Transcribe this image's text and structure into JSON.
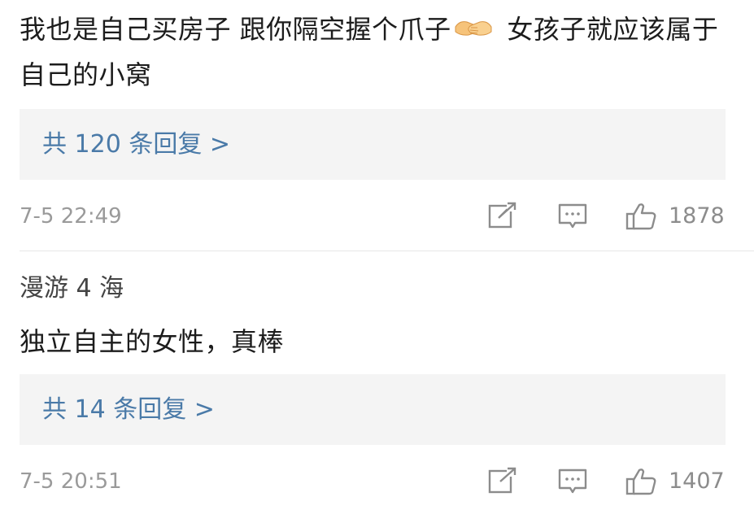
{
  "comments": [
    {
      "text_before_emoji": "我也是自己买房子  跟你隔空握个爪子",
      "emoji": "handshake-emoji",
      "text_after_emoji": " 女孩子就应该属于自己的小窝",
      "replies_label": "共 120 条回复 >",
      "time": "7-5 22:49",
      "likes": "1878"
    },
    {
      "username": "漫游 4 海",
      "text": "独立自主的女性，真棒",
      "replies_label": "共 14 条回复 >",
      "time": "7-5 20:51",
      "likes": "1407"
    }
  ],
  "icons": {
    "share": "share-icon",
    "comment": "comment-icon",
    "like": "thumbs-up-icon"
  },
  "colors": {
    "reply_link": "#4a7aa8",
    "reply_box_bg": "#f4f4f4",
    "meta_text": "#9a9a9a"
  }
}
